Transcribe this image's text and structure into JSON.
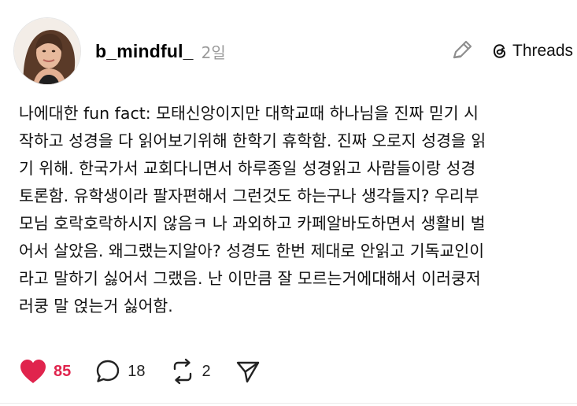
{
  "post": {
    "author": {
      "username": "b_mindful_",
      "avatar": "profile-photo"
    },
    "timestamp": "2일",
    "source": {
      "label": "Threads",
      "icon": "threads-logo-icon"
    },
    "body": "나에대한 fun fact: 모태신앙이지만 대학교때 하나님을 진짜 믿기 시\n작하고 성경을 다 읽어보기위해 한학기 휴학함. 진짜 오로지 성경을 읽\n기 위해. 한국가서 교회다니면서 하루종일 성경읽고 사람들이랑 성경\n토론함. 유학생이라 팔자편해서 그런것도 하는구나 생각들지? 우리부\n모님 호락호락하시지 않음ㅋ 나 과외하고 카페알바도하면서 생활비 벌\n어서 살았음. 왜그랬는지알아? 성경도 한번 제대로 안읽고 기독교인이\n라고 말하기 싫어서 그랬음. 난 이만큼 잘 모르는거에대해서 이러쿵저\n러쿵 말 얹는거 싫어함.",
    "actions": {
      "likes": "85",
      "replies": "18",
      "reposts": "2"
    }
  },
  "icons": {
    "edit": "pencil-icon",
    "like": "heart-icon",
    "reply": "speech-bubble-icon",
    "repost": "repost-icon",
    "share": "send-icon"
  },
  "colors": {
    "like_active": "#e0244d",
    "muted_text": "#9a9a9a"
  }
}
